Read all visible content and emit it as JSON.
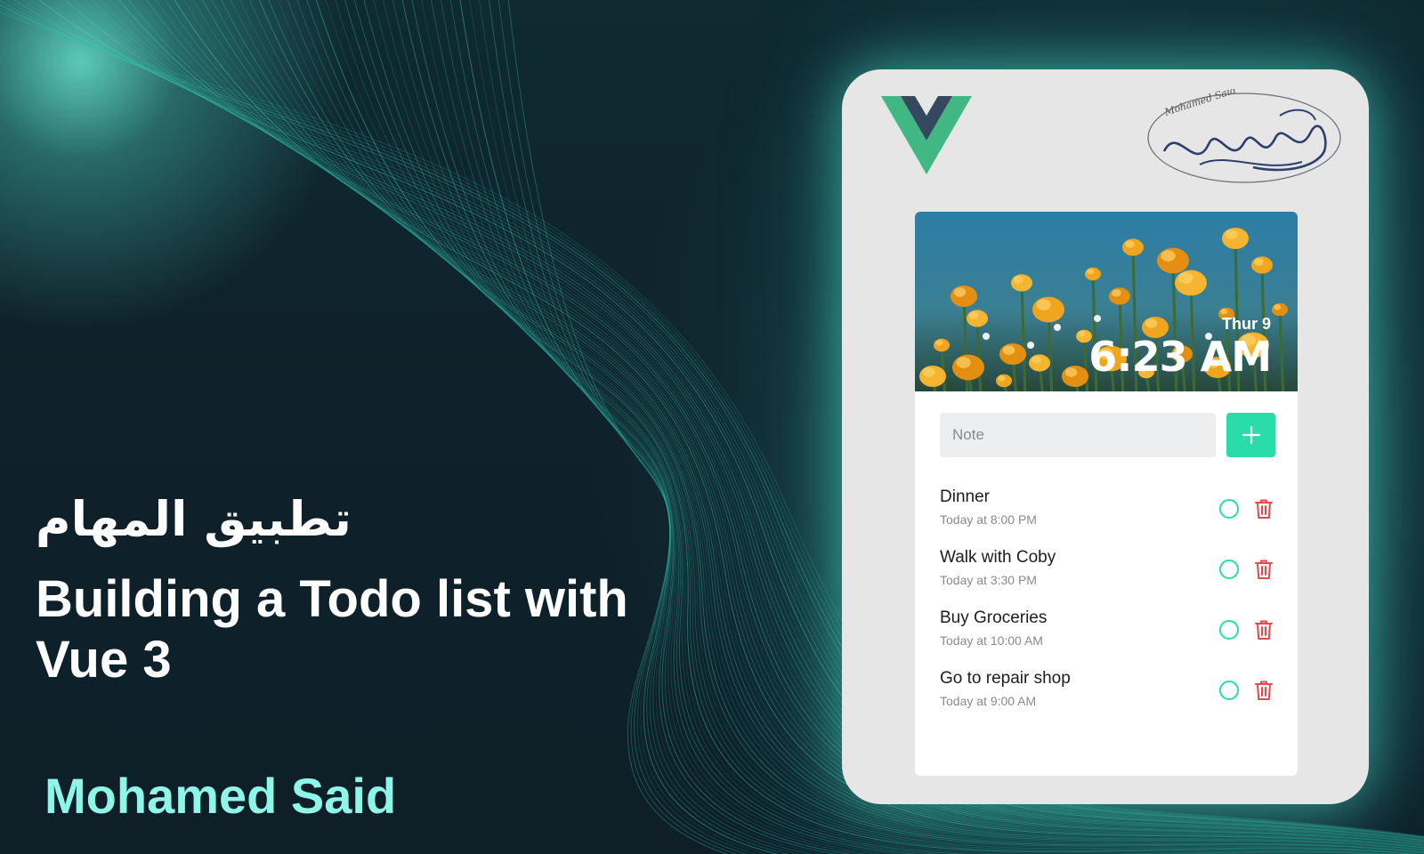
{
  "headline": {
    "arabic_title": "تطبيق المهام",
    "title": "Building a Todo list with Vue 3",
    "author": "Mohamed Said"
  },
  "app": {
    "date_label": "Thur 9",
    "time_label": "6:23 AM",
    "note_placeholder": "Note",
    "note_value": "",
    "add_icon": "plus-icon",
    "todos": [
      {
        "title": "Dinner",
        "time": "Today at 8:00 PM"
      },
      {
        "title": "Walk with Coby",
        "time": "Today at 3:30 PM"
      },
      {
        "title": "Buy Groceries",
        "time": "Today at 10:00 AM"
      },
      {
        "title": "Go to repair shop",
        "time": "Today at 9:00 AM"
      }
    ],
    "signature_text": "Mohamed Said"
  },
  "colors": {
    "accent": "#2bdcab",
    "delete": "#e5484d",
    "author": "#8ff5e8",
    "vue_green": "#41b883",
    "vue_dark": "#35495e"
  }
}
